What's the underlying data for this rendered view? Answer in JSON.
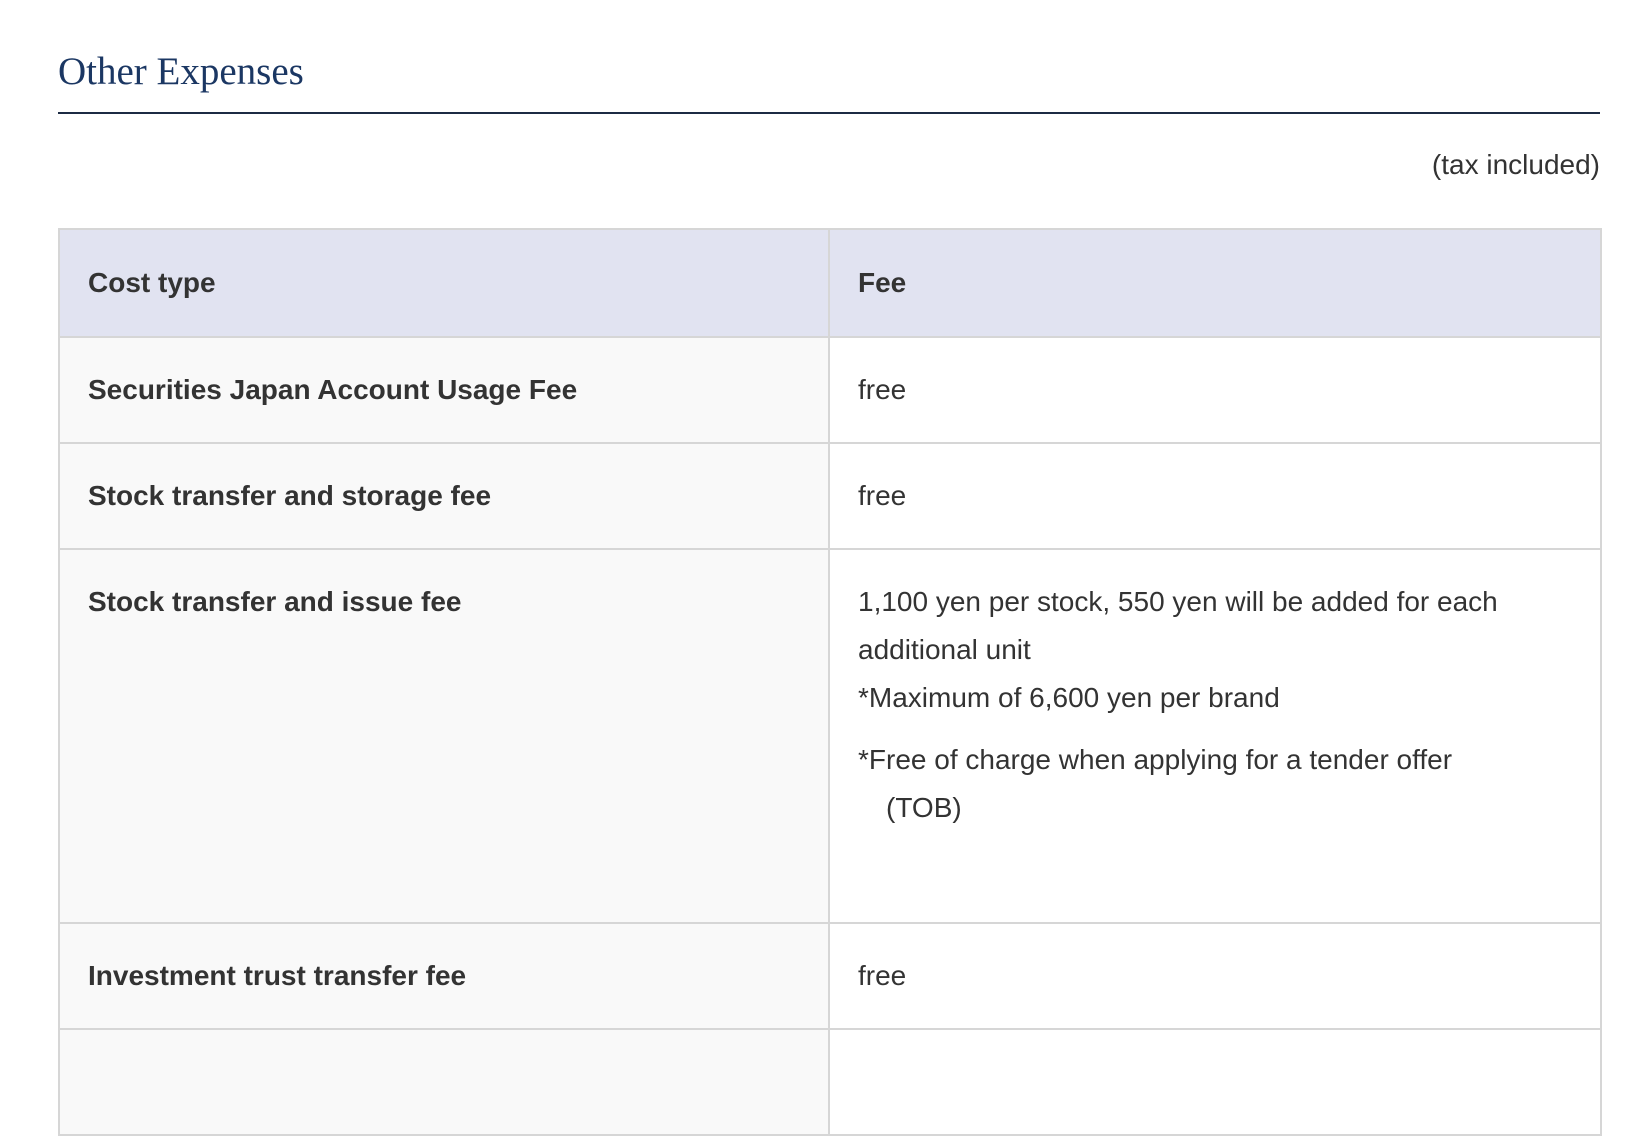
{
  "section": {
    "title": "Other Expenses",
    "tax_note": "(tax included)"
  },
  "table": {
    "headers": {
      "cost_type": "Cost type",
      "fee": "Fee"
    },
    "rows": [
      {
        "cost_type": "Securities Japan Account Usage Fee",
        "fee": "free"
      },
      {
        "cost_type": "Stock transfer and storage fee",
        "fee": "free"
      },
      {
        "cost_type": "Stock transfer and issue fee",
        "fee_main": "1,100 yen per stock, 550 yen will be added for each additional unit",
        "notes": [
          "*Maximum of 6,600 yen per brand",
          "*Free of charge when applying for a tender offer",
          "(TOB)"
        ]
      },
      {
        "cost_type": "Investment trust transfer fee",
        "fee": "free"
      }
    ]
  }
}
